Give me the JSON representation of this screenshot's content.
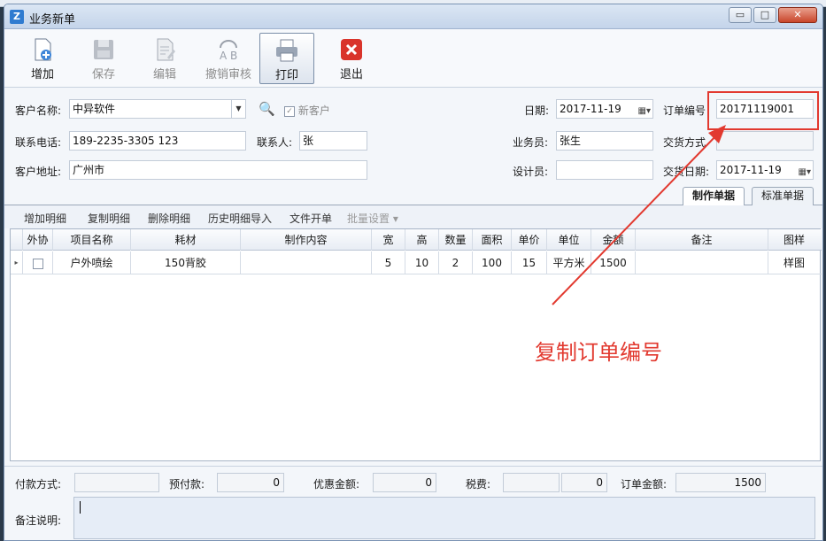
{
  "window": {
    "title": "业务新单",
    "controls": {
      "minimize": "▭",
      "maximize": "□",
      "close": "✕"
    }
  },
  "toolbar": [
    {
      "label": "增加",
      "icon": "add-document-icon",
      "state": "enabled"
    },
    {
      "label": "保存",
      "icon": "floppy-disk-icon",
      "state": "disabled"
    },
    {
      "label": "编辑",
      "icon": "edit-document-icon",
      "state": "disabled"
    },
    {
      "label": "撤销审核",
      "icon": "undo-review-icon",
      "state": "disabled"
    },
    {
      "label": "打印",
      "icon": "printer-icon",
      "state": "active"
    },
    {
      "label": "退出",
      "icon": "exit-x-icon",
      "state": "enabled"
    }
  ],
  "form": {
    "customer_name_label": "客户名称:",
    "customer_name_value": "中异软件",
    "new_customer_label": "新客户",
    "phone_label": "联系电话:",
    "phone_value": "189-2235-3305 123",
    "contact_label": "联系人:",
    "contact_value": "张",
    "address_label": "客户地址:",
    "address_value": "广州市",
    "date_label": "日期:",
    "date_value": "2017-11-19",
    "order_no_label": "订单编号",
    "order_no_value": "20171119001",
    "salesman_label": "业务员:",
    "salesman_value": "张生",
    "delivery_method_label": "交货方式",
    "delivery_method_value": "",
    "designer_label": "设计员:",
    "designer_value": "",
    "delivery_date_label": "交货日期:",
    "delivery_date_value": "2017-11-19"
  },
  "tabs": [
    {
      "label": "制作单据",
      "selected": true
    },
    {
      "label": "标准单据",
      "selected": false
    }
  ],
  "detail_toolbar": [
    {
      "label": "增加明细",
      "enabled": true
    },
    {
      "label": "复制明细",
      "enabled": true
    },
    {
      "label": "删除明细",
      "enabled": true
    },
    {
      "label": "历史明细导入",
      "enabled": true
    },
    {
      "label": "文件开单",
      "enabled": true
    },
    {
      "label": "批量设置 ▾",
      "enabled": false
    }
  ],
  "grid": {
    "columns": [
      "外协",
      "项目名称",
      "耗材",
      "制作内容",
      "宽",
      "高",
      "数量",
      "面积",
      "单价",
      "单位",
      "金额",
      "备注",
      "图样"
    ],
    "rows": [
      {
        "outsource": false,
        "cells": [
          "户外喷绘",
          "150背胶",
          "",
          "5",
          "10",
          "2",
          "100",
          "15",
          "平方米",
          "1500",
          "",
          "样图"
        ]
      }
    ]
  },
  "annotation": "复制订单编号",
  "footer": {
    "payment_method_label": "付款方式:",
    "payment_method_value": "",
    "prepaid_label": "预付款:",
    "prepaid_value": "0",
    "discount_label": "优惠金额:",
    "discount_value": "0",
    "tax_label": "税费:",
    "tax_value": "0",
    "order_amount_label": "订单金额:",
    "order_amount_value": "1500",
    "memo_label": "备注说明:",
    "memo_value": ""
  },
  "colors": {
    "annotation_red": "#e2392f",
    "accent_blue": "#2f7bd0"
  }
}
